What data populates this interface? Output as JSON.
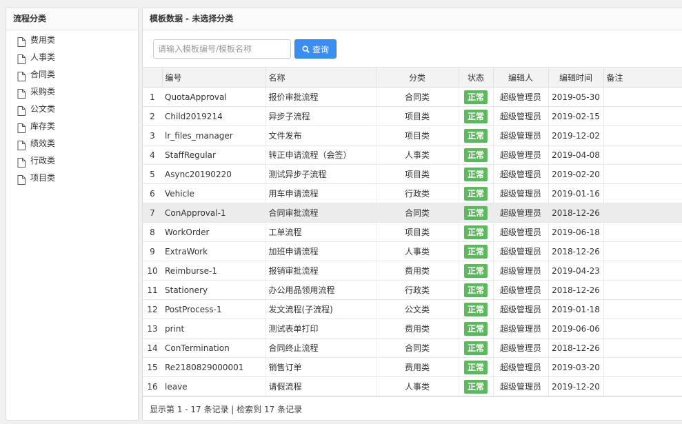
{
  "sidebar": {
    "title": "流程分类",
    "items": [
      {
        "label": "费用类"
      },
      {
        "label": "人事类"
      },
      {
        "label": "合同类"
      },
      {
        "label": "采购类"
      },
      {
        "label": "公文类"
      },
      {
        "label": "库存类"
      },
      {
        "label": "绩效类"
      },
      {
        "label": "行政类"
      },
      {
        "label": "项目类"
      }
    ]
  },
  "main": {
    "title": "模板数据 - 未选择分类",
    "search": {
      "placeholder": "请输入模板编号/模板名称",
      "value": "",
      "button_label": "查询"
    },
    "columns": [
      "编号",
      "名称",
      "分类",
      "状态",
      "编辑人",
      "编辑时间",
      "备注"
    ],
    "rows": [
      {
        "no": "1",
        "code": "QuotaApproval",
        "name": "报价审批流程",
        "category": "合同类",
        "status": "正常",
        "editor": "超级管理员",
        "date": "2019-05-30",
        "note": ""
      },
      {
        "no": "2",
        "code": "Child2019214",
        "name": "异步子流程",
        "category": "项目类",
        "status": "正常",
        "editor": "超级管理员",
        "date": "2019-02-15",
        "note": ""
      },
      {
        "no": "3",
        "code": "lr_files_manager",
        "name": "文件发布",
        "category": "项目类",
        "status": "正常",
        "editor": "超级管理员",
        "date": "2019-12-02",
        "note": ""
      },
      {
        "no": "4",
        "code": "StaffRegular",
        "name": "转正申请流程（会签）",
        "category": "人事类",
        "status": "正常",
        "editor": "超级管理员",
        "date": "2019-04-08",
        "note": ""
      },
      {
        "no": "5",
        "code": "Async20190220",
        "name": "测试异步子流程",
        "category": "项目类",
        "status": "正常",
        "editor": "超级管理员",
        "date": "2019-02-20",
        "note": ""
      },
      {
        "no": "6",
        "code": "Vehicle",
        "name": "用车申请流程",
        "category": "行政类",
        "status": "正常",
        "editor": "超级管理员",
        "date": "2019-01-16",
        "note": ""
      },
      {
        "no": "7",
        "code": "ConApproval-1",
        "name": "合同审批流程",
        "category": "合同类",
        "status": "正常",
        "editor": "超级管理员",
        "date": "2018-12-26",
        "note": ""
      },
      {
        "no": "8",
        "code": "WorkOrder",
        "name": "工单流程",
        "category": "项目类",
        "status": "正常",
        "editor": "超级管理员",
        "date": "2019-06-18",
        "note": ""
      },
      {
        "no": "9",
        "code": "ExtraWork",
        "name": "加班申请流程",
        "category": "人事类",
        "status": "正常",
        "editor": "超级管理员",
        "date": "2018-12-26",
        "note": ""
      },
      {
        "no": "10",
        "code": "Reimburse-1",
        "name": "报销审批流程",
        "category": "费用类",
        "status": "正常",
        "editor": "超级管理员",
        "date": "2019-04-23",
        "note": ""
      },
      {
        "no": "11",
        "code": "Stationery",
        "name": "办公用品领用流程",
        "category": "行政类",
        "status": "正常",
        "editor": "超级管理员",
        "date": "2018-12-26",
        "note": ""
      },
      {
        "no": "12",
        "code": "PostProcess-1",
        "name": "发文流程(子流程)",
        "category": "公文类",
        "status": "正常",
        "editor": "超级管理员",
        "date": "2019-01-18",
        "note": ""
      },
      {
        "no": "13",
        "code": "print",
        "name": "测试表单打印",
        "category": "费用类",
        "status": "正常",
        "editor": "超级管理员",
        "date": "2019-06-06",
        "note": ""
      },
      {
        "no": "14",
        "code": "ConTermination",
        "name": "合同终止流程",
        "category": "合同类",
        "status": "正常",
        "editor": "超级管理员",
        "date": "2018-12-26",
        "note": ""
      },
      {
        "no": "15",
        "code": "Re2180829000001",
        "name": "销售订单",
        "category": "费用类",
        "status": "正常",
        "editor": "超级管理员",
        "date": "2019-03-20",
        "note": ""
      },
      {
        "no": "16",
        "code": "leave",
        "name": "请假流程",
        "category": "人事类",
        "status": "正常",
        "editor": "超级管理员",
        "date": "2019-12-20",
        "note": ""
      }
    ],
    "selected_row": 6,
    "footer": "显示第 1 - 17 条记录 | 检索到 17 条记录"
  },
  "colors": {
    "accent": "#3c8dec",
    "status_ok": "#5cb85c",
    "selected_row_bg": "#ececec"
  }
}
